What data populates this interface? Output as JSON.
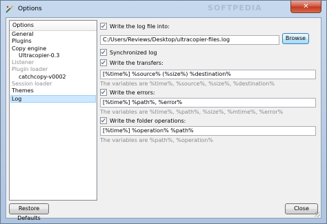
{
  "window": {
    "title": "Options",
    "watermark": "SOFTPEDIA",
    "close_glyph": "✕",
    "icon": "app-icon"
  },
  "sidebar": {
    "header": "Options",
    "items": [
      {
        "label": "General"
      },
      {
        "label": "Plugins"
      },
      {
        "label": "Copy engine"
      },
      {
        "label": "Ultracopier-0.3"
      },
      {
        "label": "Listener"
      },
      {
        "label": "Plugin loader"
      },
      {
        "label": "catchcopy-v0002"
      },
      {
        "label": "Session loader"
      },
      {
        "label": "Themes"
      },
      {
        "label": "Log"
      }
    ]
  },
  "log": {
    "write_log_label": "Write the log file into:",
    "log_path": "C:/Users/Reviews/Desktop/ultracopier-files.log",
    "browse_label": "Browse",
    "synchronized_label": "Synchronized log",
    "transfers_label": "Write the transfers:",
    "transfers_value": "[%time%] %source% (%size%) %destination%",
    "transfers_hint": "The variables are %time%, %source%, %size%, %destination%",
    "errors_label": "Write the errors:",
    "errors_value": "[%time%] %path%, %error%",
    "errors_hint": "The variables are %time%, %path%, %size%, %mtime%, %error%",
    "folder_label": "Write the folder operations:",
    "folder_value": "[%time%] %operation% %path%",
    "folder_hint": "The variables are %path%, %operation%"
  },
  "footer": {
    "restore_label": "Restore Defaults",
    "close_label": "Close"
  }
}
